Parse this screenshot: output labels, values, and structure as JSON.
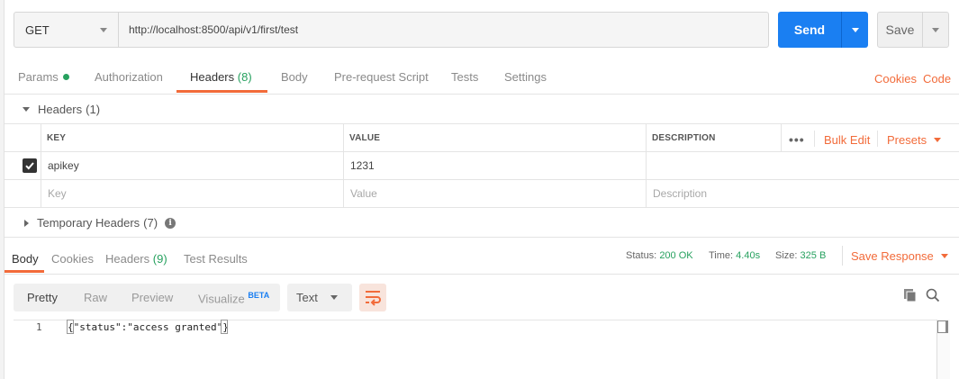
{
  "request": {
    "method": "GET",
    "url": "http://localhost:8500/api/v1/first/test",
    "send_label": "Send",
    "save_label": "Save"
  },
  "request_tabs": [
    {
      "label": "Params",
      "count": ""
    },
    {
      "label": "Authorization",
      "count": ""
    },
    {
      "label": "Headers",
      "count": "(8)"
    },
    {
      "label": "Body",
      "count": ""
    },
    {
      "label": "Pre-request Script",
      "count": ""
    },
    {
      "label": "Tests",
      "count": ""
    },
    {
      "label": "Settings",
      "count": ""
    }
  ],
  "links": {
    "cookies": "Cookies",
    "code": "Code"
  },
  "headers_section": {
    "title": "Headers",
    "count": "(1)",
    "columns": {
      "key": "KEY",
      "value": "VALUE",
      "description": "DESCRIPTION"
    },
    "bulk_edit": "Bulk Edit",
    "presets": "Presets",
    "more": "•••",
    "rows": [
      {
        "key": "apikey",
        "value": "1231",
        "description": "",
        "checked": true
      }
    ],
    "placeholders": {
      "key": "Key",
      "value": "Value",
      "description": "Description"
    }
  },
  "temporary_headers": {
    "title": "Temporary Headers",
    "count": "(7)"
  },
  "response": {
    "tabs": [
      {
        "label": "Body",
        "count": ""
      },
      {
        "label": "Cookies",
        "count": ""
      },
      {
        "label": "Headers",
        "count": "(9)"
      },
      {
        "label": "Test Results",
        "count": ""
      }
    ],
    "status_label": "Status:",
    "status_value": "200 OK",
    "time_label": "Time:",
    "time_value": "4.40s",
    "size_label": "Size:",
    "size_value": "325 B",
    "save_response": "Save Response",
    "view_modes": [
      "Pretty",
      "Raw",
      "Preview",
      "Visualize"
    ],
    "beta": "BETA",
    "format": "Text",
    "lines": [
      {
        "number": "1",
        "open": "{",
        "body": "\"status\":\"access granted\"",
        "close": "}"
      }
    ]
  },
  "colors": {
    "accent": "#f26b3a",
    "primary": "#1a7ff2",
    "success": "#27a15f"
  },
  "icons": [
    "check-icon",
    "info-icon",
    "wrap-lines-icon",
    "copy-icon",
    "search-icon",
    "caret-down-icon",
    "caret-right-icon"
  ]
}
